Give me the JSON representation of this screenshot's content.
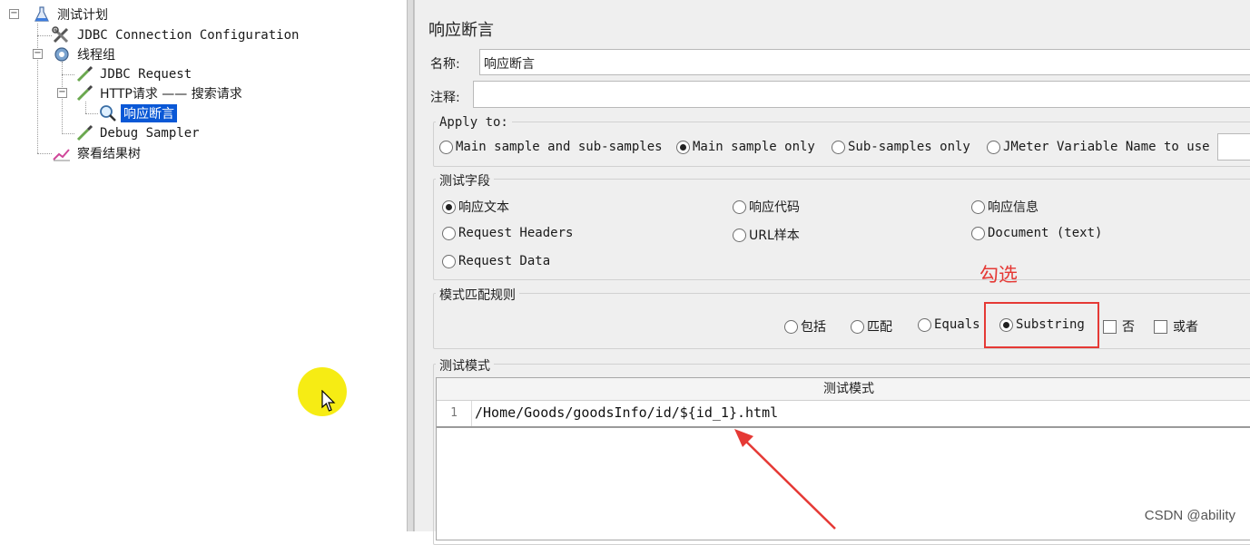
{
  "tree": {
    "items": [
      {
        "label": "测试计划",
        "icon": "test-plan-flask-icon"
      },
      {
        "label": "JDBC Connection Configuration",
        "icon": "wrench-config-icon"
      },
      {
        "label": "线程组",
        "icon": "gear-thread-group-icon"
      },
      {
        "label": "JDBC Request",
        "icon": "pipette-sampler-icon"
      },
      {
        "label": "HTTP请求 —— 搜索请求",
        "icon": "pipette-sampler-icon"
      },
      {
        "label": "响应断言",
        "icon": "magnifier-assertion-icon",
        "selected": true
      },
      {
        "label": "Debug Sampler",
        "icon": "pipette-sampler-icon"
      },
      {
        "label": "察看结果树",
        "icon": "chart-listener-icon"
      }
    ]
  },
  "panel": {
    "title": "响应断言",
    "name_label": "名称:",
    "name_value": "响应断言",
    "comment_label": "注释:",
    "comment_value": ""
  },
  "apply_to": {
    "title": "Apply to:",
    "options": [
      {
        "label": "Main sample and sub-samples",
        "selected": false
      },
      {
        "label": "Main sample only",
        "selected": true
      },
      {
        "label": "Sub-samples only",
        "selected": false
      },
      {
        "label": "JMeter Variable Name to use",
        "selected": false
      }
    ]
  },
  "test_field": {
    "title": "测试字段",
    "options": [
      {
        "label": "响应文本",
        "selected": true
      },
      {
        "label": "响应代码",
        "selected": false
      },
      {
        "label": "响应信息",
        "selected": false
      },
      {
        "label": "Request Headers",
        "selected": false
      },
      {
        "label": "URL样本",
        "selected": false
      },
      {
        "label": "Document (text)",
        "selected": false
      },
      {
        "label": "Request Data",
        "selected": false
      }
    ]
  },
  "matching_rules": {
    "title": "模式匹配规则",
    "options": [
      {
        "label": "包括",
        "selected": false
      },
      {
        "label": "匹配",
        "selected": false
      },
      {
        "label": "Equals",
        "selected": false
      },
      {
        "label": "Substring",
        "selected": true
      }
    ],
    "checkboxes": [
      {
        "label": "否",
        "checked": false
      },
      {
        "label": "或者",
        "checked": false
      }
    ]
  },
  "annotation": {
    "note": "勾选",
    "color": "#e53935"
  },
  "patterns": {
    "title": "测试模式",
    "column_header": "测试模式",
    "rows": [
      {
        "line": "1",
        "value": "/Home/Goods/goodsInfo/id/${id_1}.html"
      }
    ]
  },
  "watermark": "CSDN @ability",
  "colors": {
    "selection": "#0a58d6",
    "annotation_red": "#e53935",
    "cursor_highlight": "#f5ea00"
  }
}
